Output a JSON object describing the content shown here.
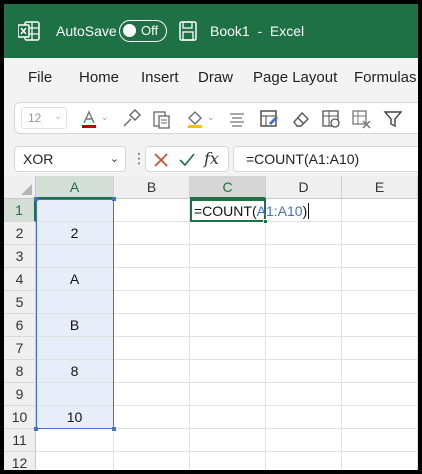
{
  "titlebar": {
    "autosave_label": "AutoSave",
    "autosave_state": "Off",
    "document_title": "Book1  -  Excel",
    "bg_color": "#1e7145"
  },
  "ribbon": {
    "tabs": [
      {
        "label": "File"
      },
      {
        "label": "Home"
      },
      {
        "label": "Insert"
      },
      {
        "label": "Draw"
      },
      {
        "label": "Page Layout"
      },
      {
        "label": "Formulas"
      }
    ],
    "font_size": "12",
    "toolbar_icons": [
      "font-color-icon",
      "format-painter-icon",
      "paste-special-icon",
      "fill-color-icon",
      "align-icon",
      "accessibility-check-icon",
      "clear-icon",
      "conditional-format-icon",
      "delete-format-icon",
      "filter-icon"
    ]
  },
  "formula_bar": {
    "name_box": "XOR",
    "fx_label": "fx",
    "formula": "=COUNT(A1:A10)"
  },
  "grid": {
    "columns": [
      "A",
      "B",
      "C",
      "D",
      "E"
    ],
    "rows": [
      "1",
      "2",
      "3",
      "4",
      "5",
      "6",
      "7",
      "8",
      "9",
      "10",
      "11",
      "12"
    ],
    "cells": {
      "A1": "",
      "A2": "2",
      "A3": "",
      "A4": "A",
      "A5": "",
      "A6": "B",
      "A7": "",
      "A8": "8",
      "A9": "",
      "A10": "10"
    },
    "active_cell": {
      "address": "C1",
      "prefix": "=COUNT(",
      "ref": "A1:A10",
      "suffix": ")"
    },
    "selected_range": "A1:A10",
    "accent_color": "#1e7145",
    "range_color": "#4472c4"
  }
}
